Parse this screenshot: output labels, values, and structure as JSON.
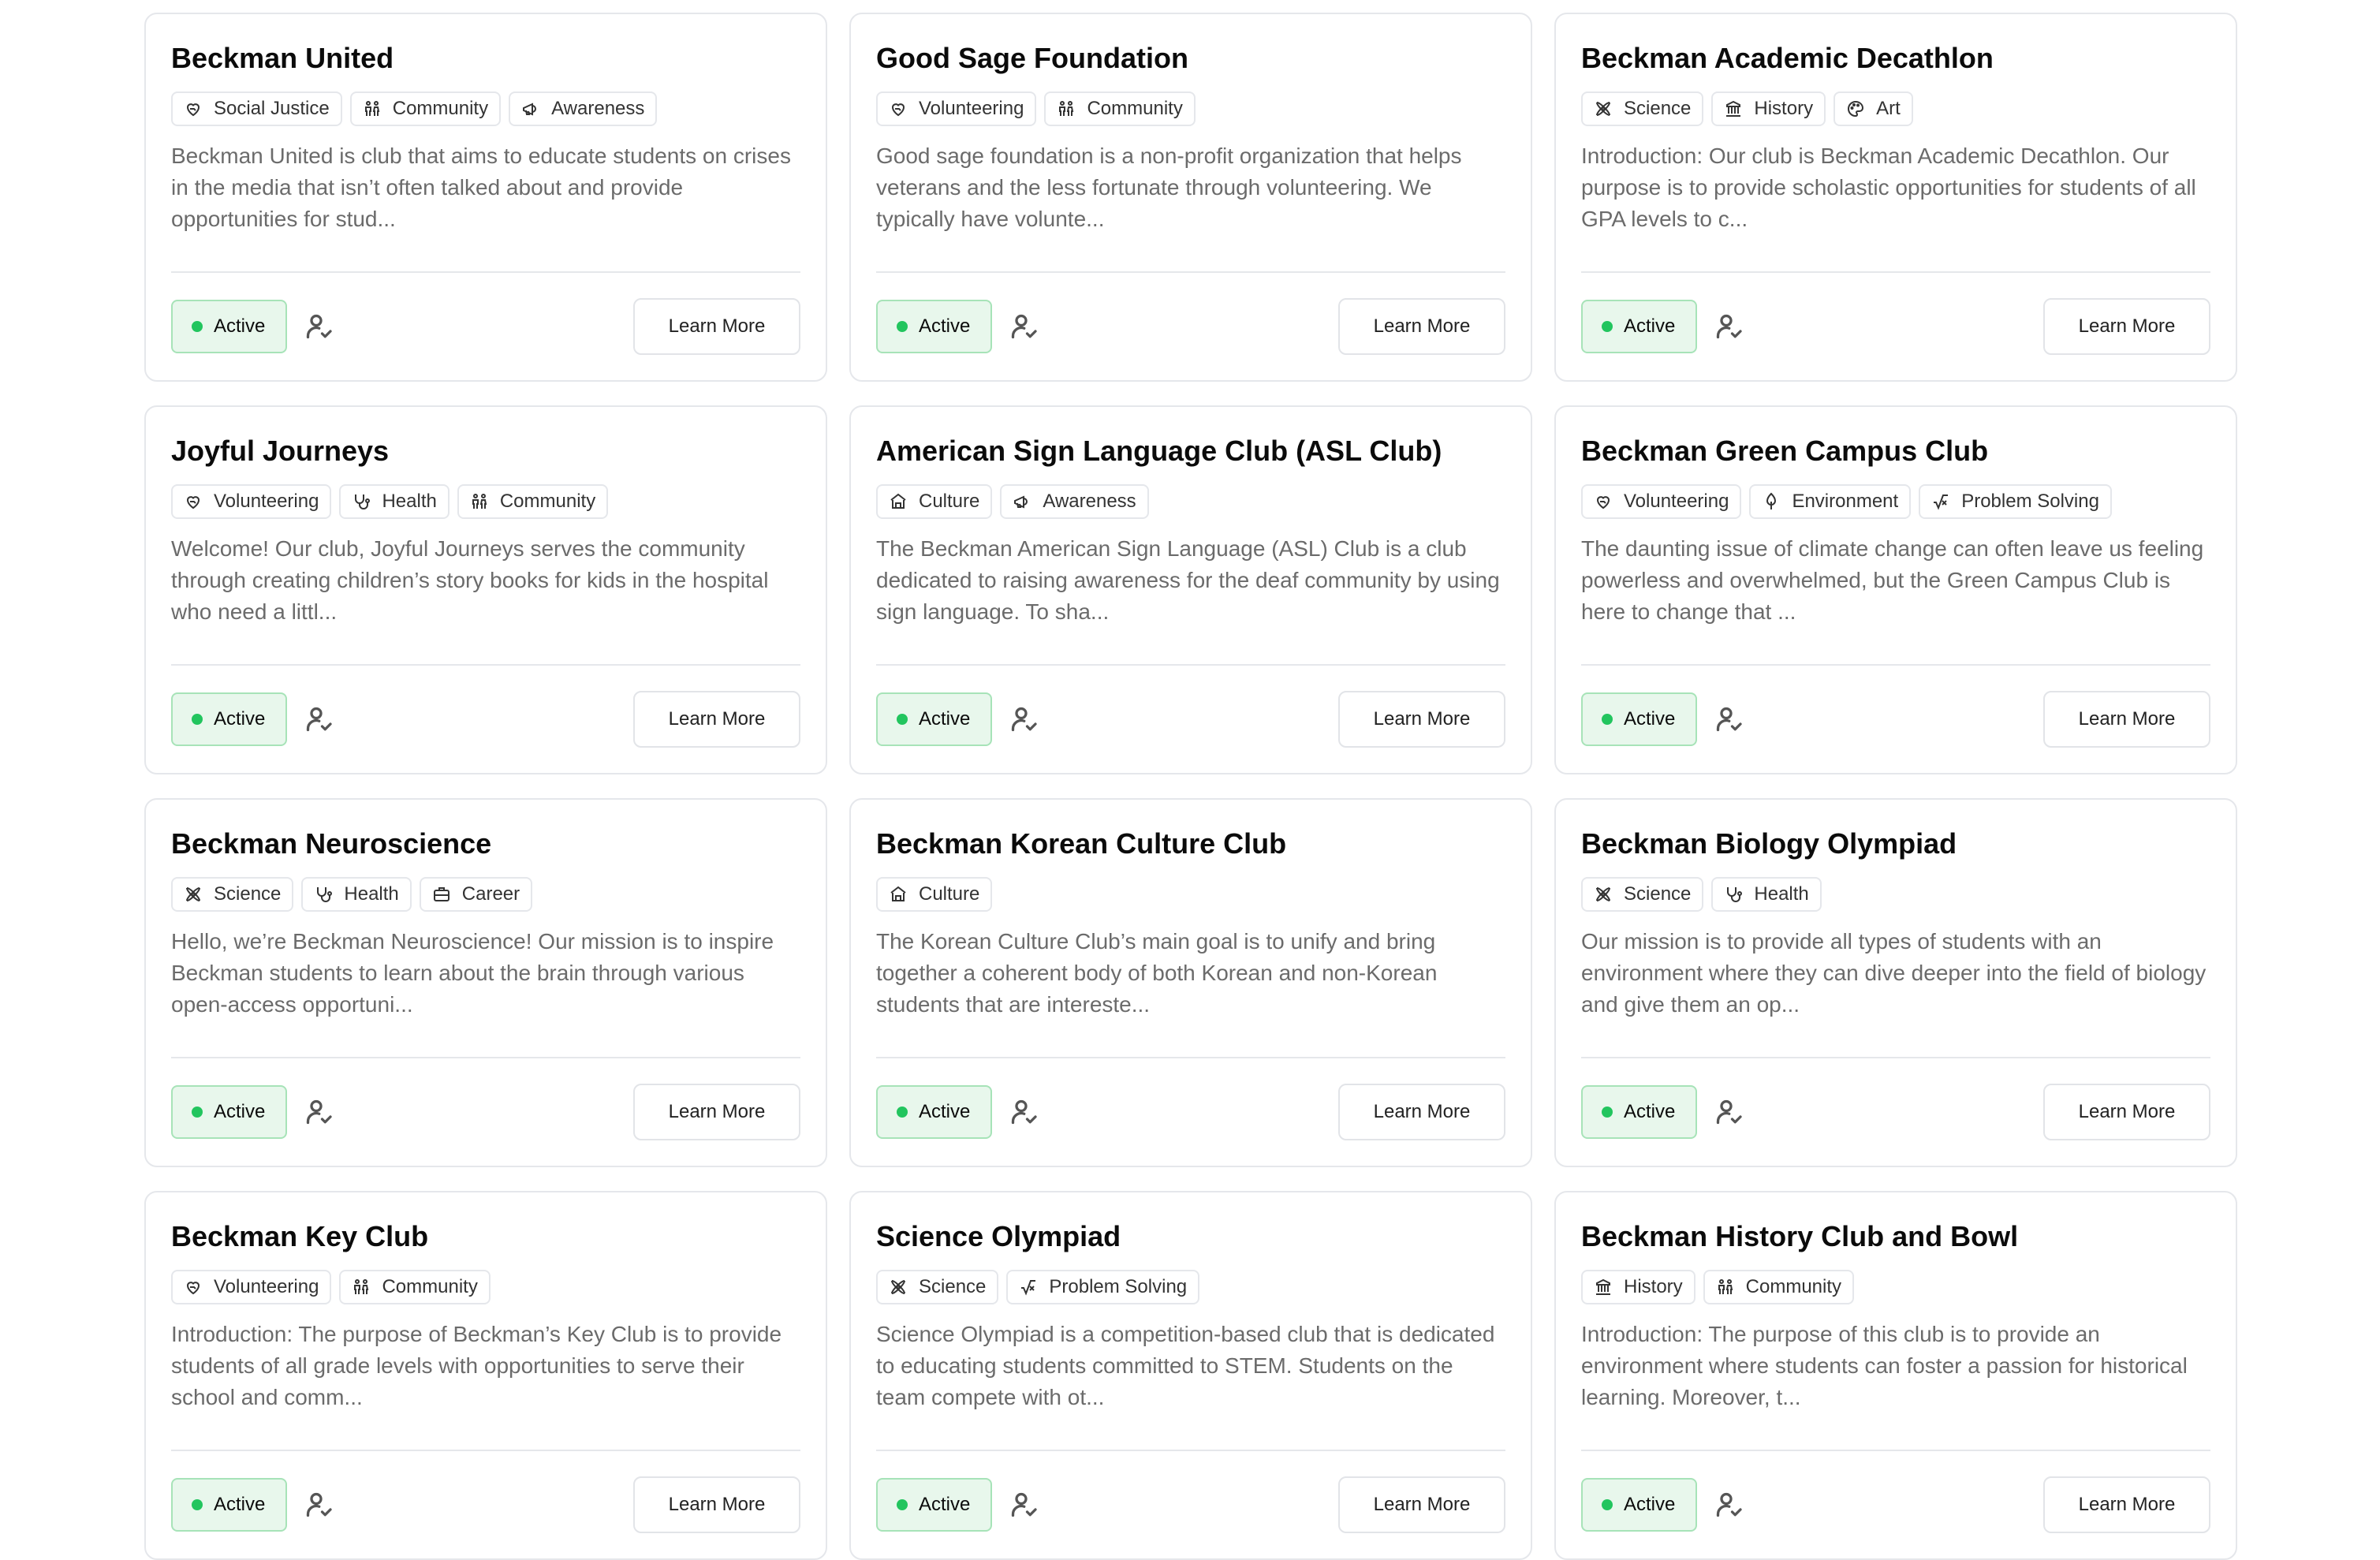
{
  "status_label": "Active",
  "learn_more_label": "Learn More",
  "clubs": [
    {
      "name": "Beckman United",
      "tags": [
        {
          "label": "Social Justice",
          "icon": "heart-hand-icon"
        },
        {
          "label": "Community",
          "icon": "people-icon"
        },
        {
          "label": "Awareness",
          "icon": "megaphone-icon"
        }
      ],
      "description": "Beckman United is club that aims to educate students on crises in the media that isn’t often talked about and provide opportunities for stud..."
    },
    {
      "name": "Good Sage Foundation",
      "tags": [
        {
          "label": "Volunteering",
          "icon": "heart-hand-icon"
        },
        {
          "label": "Community",
          "icon": "people-icon"
        }
      ],
      "description": "Good sage foundation is a non-profit organization that helps veterans and the less fortunate through volunteering. We typically have volunte..."
    },
    {
      "name": "Beckman Academic Decathlon",
      "tags": [
        {
          "label": "Science",
          "icon": "atom-icon"
        },
        {
          "label": "History",
          "icon": "building-icon"
        },
        {
          "label": "Art",
          "icon": "palette-icon"
        }
      ],
      "description": "Introduction: Our club is Beckman Academic Decathlon. Our purpose is to provide scholastic opportunities for students of all GPA levels to c..."
    },
    {
      "name": "Joyful Journeys",
      "tags": [
        {
          "label": "Volunteering",
          "icon": "heart-hand-icon"
        },
        {
          "label": "Health",
          "icon": "stethoscope-icon"
        },
        {
          "label": "Community",
          "icon": "people-icon"
        }
      ],
      "description": "Welcome!    Our club, Joyful Journeys serves the community through creating children’s story books for kids in the hospital who need a littl..."
    },
    {
      "name": "American Sign Language Club (ASL Club)",
      "tags": [
        {
          "label": "Culture",
          "icon": "temple-icon"
        },
        {
          "label": "Awareness",
          "icon": "megaphone-icon"
        }
      ],
      "description": "The Beckman American Sign Language (ASL) Club is a club dedicated to raising awareness for the deaf community by using sign language. To sha..."
    },
    {
      "name": "Beckman Green Campus Club",
      "tags": [
        {
          "label": "Volunteering",
          "icon": "heart-hand-icon"
        },
        {
          "label": "Environment",
          "icon": "tree-icon"
        },
        {
          "label": "Problem Solving",
          "icon": "square-root-icon"
        }
      ],
      "description": "The daunting issue of climate change can often leave us feeling powerless and overwhelmed, but the Green Campus Club is here to change that ..."
    },
    {
      "name": "Beckman Neuroscience",
      "tags": [
        {
          "label": "Science",
          "icon": "atom-icon"
        },
        {
          "label": "Health",
          "icon": "stethoscope-icon"
        },
        {
          "label": "Career",
          "icon": "briefcase-icon"
        }
      ],
      "description": "Hello, we’re Beckman Neuroscience! Our mission is to inspire Beckman students to learn about the brain through various open-access opportuni..."
    },
    {
      "name": "Beckman Korean Culture Club",
      "tags": [
        {
          "label": "Culture",
          "icon": "temple-icon"
        }
      ],
      "description": "The Korean Culture Club’s main goal is to unify and bring together a coherent body of both Korean and non-Korean students that are intereste..."
    },
    {
      "name": "Beckman Biology Olympiad",
      "tags": [
        {
          "label": "Science",
          "icon": "atom-icon"
        },
        {
          "label": "Health",
          "icon": "stethoscope-icon"
        }
      ],
      "description": "Our mission is to provide all types of students with an environment where they can dive deeper into the field of biology and give them an op..."
    },
    {
      "name": "Beckman Key Club",
      "tags": [
        {
          "label": "Volunteering",
          "icon": "heart-hand-icon"
        },
        {
          "label": "Community",
          "icon": "people-icon"
        }
      ],
      "description": "Introduction: The purpose of Beckman’s Key Club is to provide students of all grade levels with opportunities to serve their school and comm..."
    },
    {
      "name": "Science Olympiad",
      "tags": [
        {
          "label": "Science",
          "icon": "atom-icon"
        },
        {
          "label": "Problem Solving",
          "icon": "square-root-icon"
        }
      ],
      "description": "Science Olympiad is a competition-based club that is dedicated to educating students committed to STEM. Students on the team compete with ot..."
    },
    {
      "name": "Beckman History Club and Bowl",
      "tags": [
        {
          "label": "History",
          "icon": "building-icon"
        },
        {
          "label": "Community",
          "icon": "people-icon"
        }
      ],
      "description": "Introduction: The purpose of this club is to provide an environment where students can foster a passion for historical learning. Moreover, t..."
    }
  ]
}
